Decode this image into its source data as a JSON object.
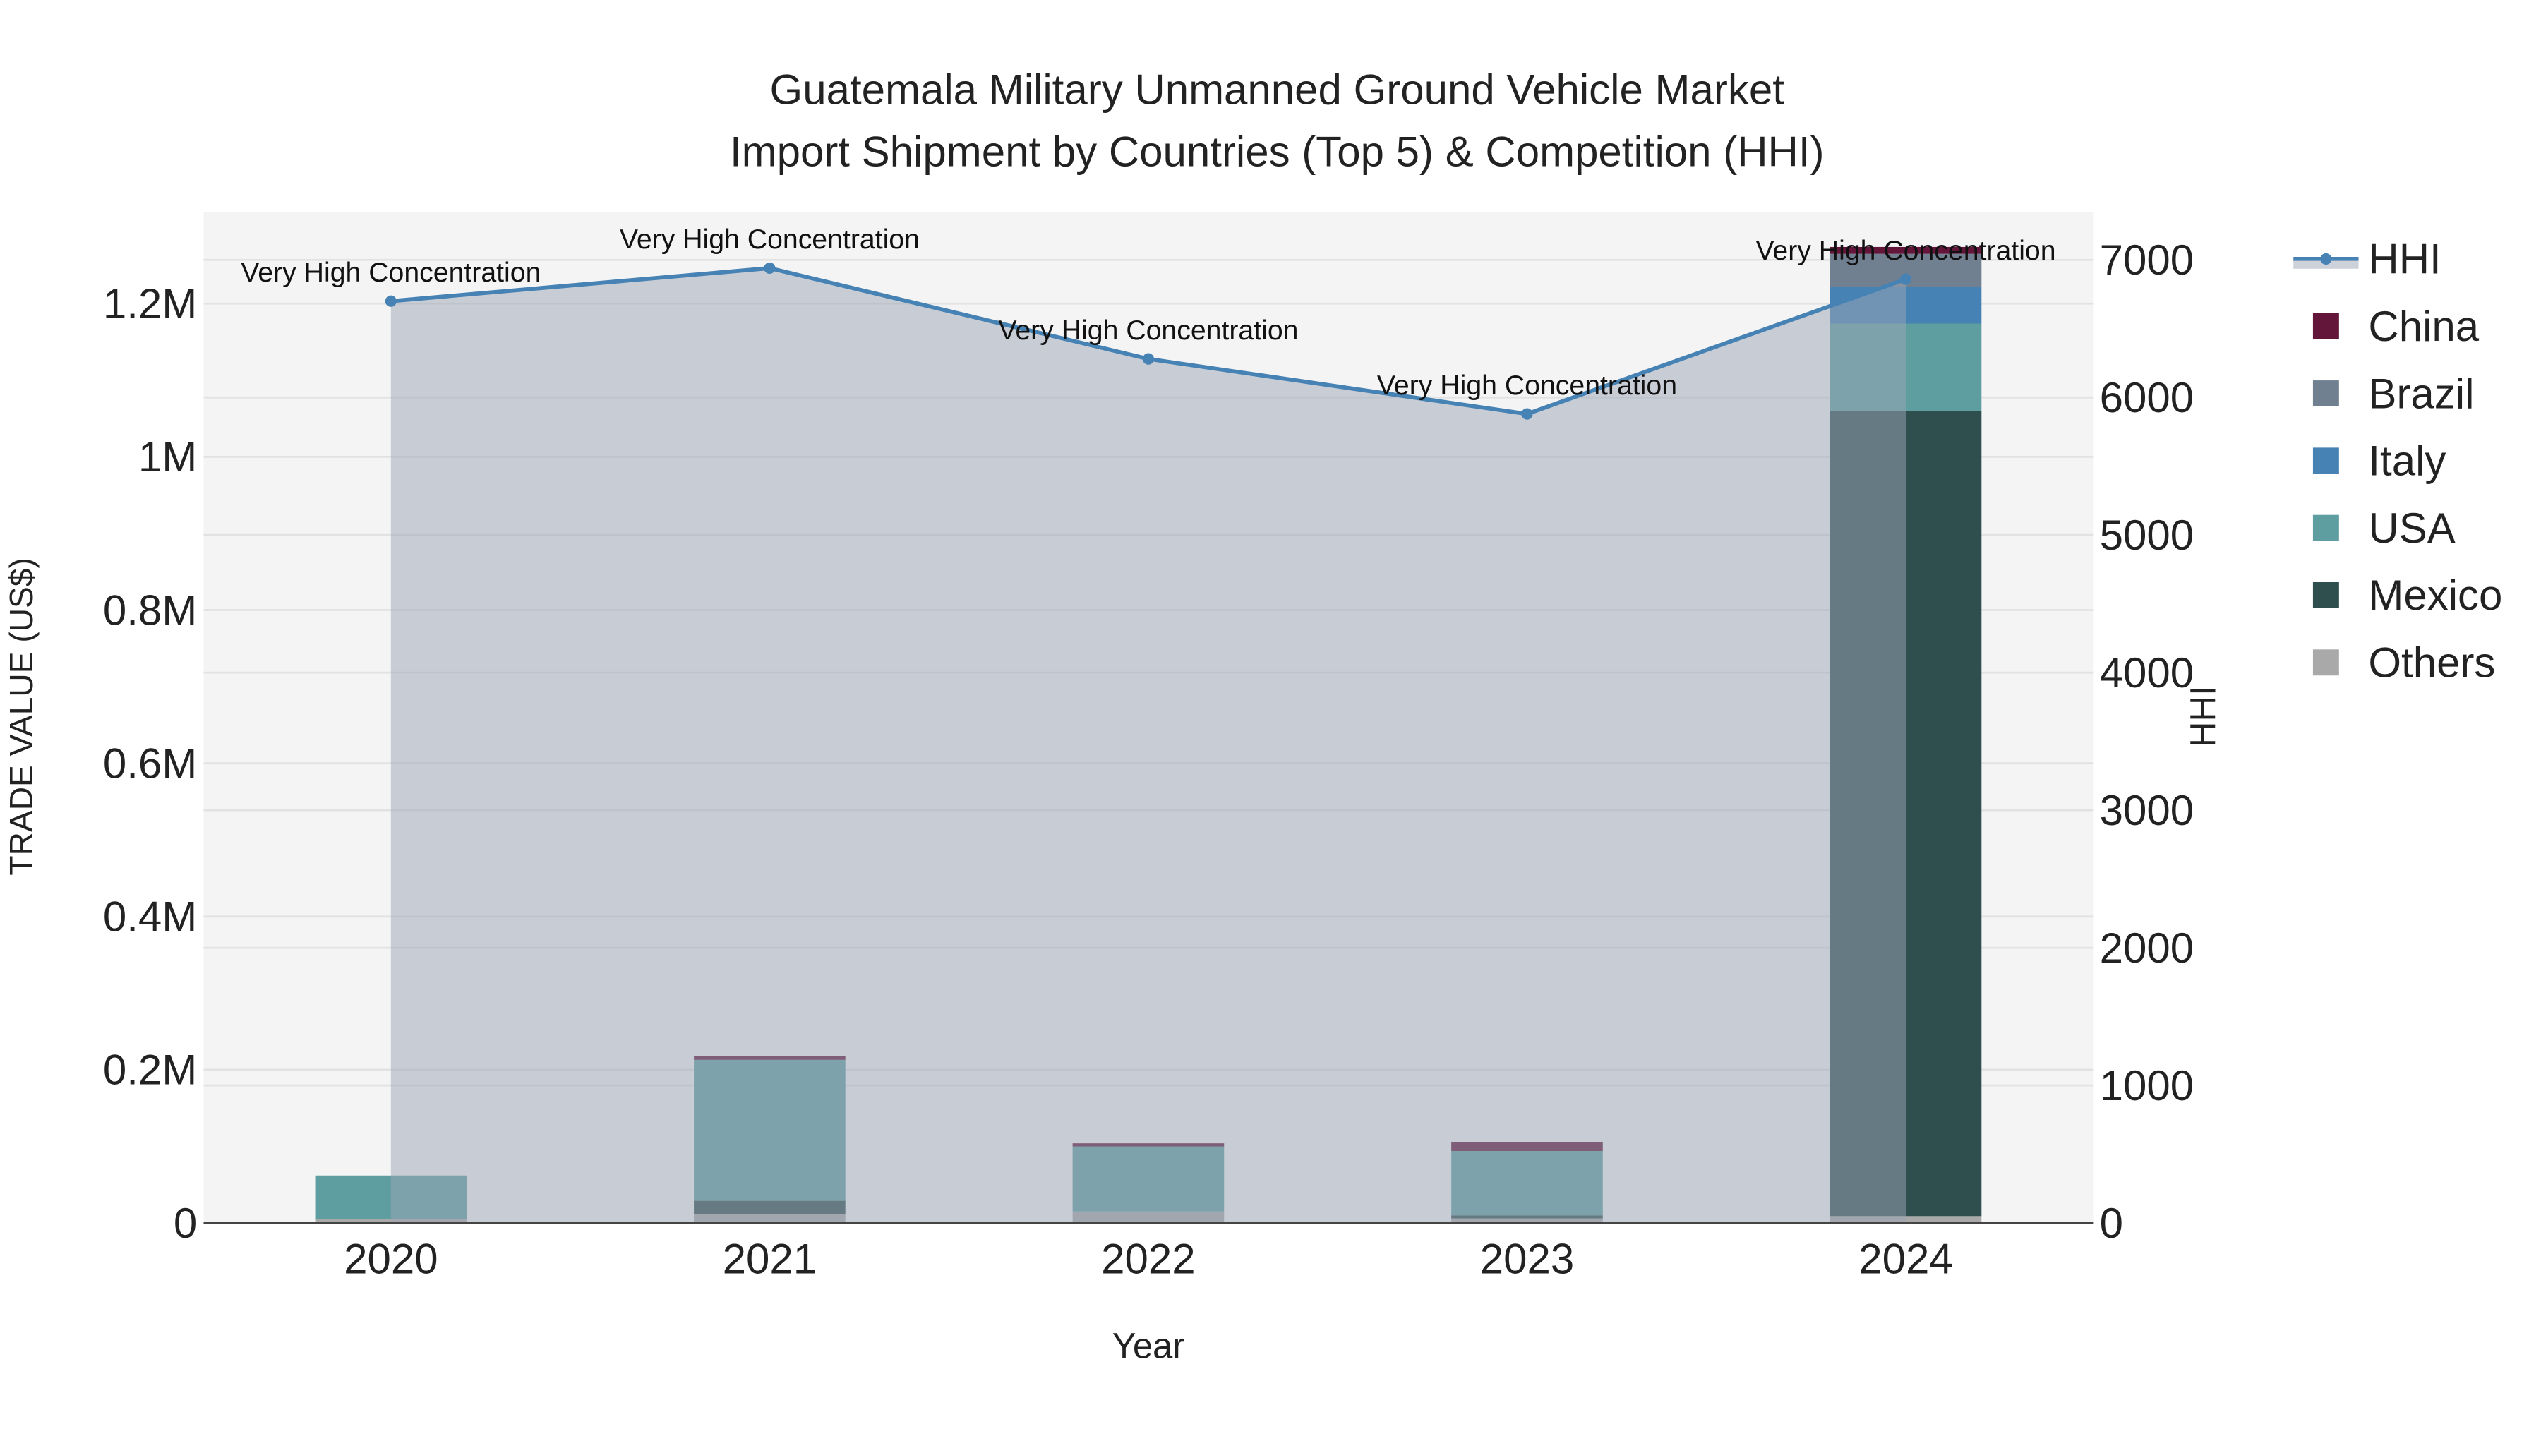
{
  "chart_data": {
    "type": "bar",
    "title_line1": "Guatemala Military Unmanned Ground Vehicle Market",
    "title_line2": "Import Shipment by Countries (Top 5) & Competition (HHI)",
    "xlabel": "Year",
    "ylabel": "TRADE VALUE (US$)",
    "y2label": "HHI",
    "categories": [
      "2020",
      "2021",
      "2022",
      "2023",
      "2024"
    ],
    "ylim": [
      0,
      1320000
    ],
    "y2lim": [
      0,
      7350
    ],
    "yticks": [
      0,
      200000,
      400000,
      600000,
      800000,
      1000000,
      1200000
    ],
    "ytick_labels": [
      "0",
      "0.2M",
      "0.4M",
      "0.6M",
      "0.8M",
      "1M",
      "1.2M"
    ],
    "y2ticks": [
      0,
      1000,
      2000,
      3000,
      4000,
      5000,
      6000,
      7000
    ],
    "y2tick_labels": [
      "0",
      "1000",
      "2000",
      "3000",
      "4000",
      "5000",
      "6000",
      "7000"
    ],
    "stack_order": [
      "Others",
      "Mexico",
      "USA",
      "Italy",
      "Brazil",
      "China"
    ],
    "series": [
      {
        "name": "China",
        "color": "#63153a",
        "values": [
          0,
          5000,
          4000,
          12000,
          9000
        ]
      },
      {
        "name": "Brazil",
        "color": "#708090",
        "values": [
          0,
          0,
          0,
          0,
          43000
        ]
      },
      {
        "name": "Italy",
        "color": "#4682b4",
        "values": [
          0,
          0,
          0,
          0,
          48000
        ]
      },
      {
        "name": "USA",
        "color": "#5f9ea0",
        "values": [
          57000,
          184000,
          85000,
          84000,
          114000
        ]
      },
      {
        "name": "Mexico",
        "color": "#2f4f4f",
        "values": [
          0,
          17000,
          0,
          4000,
          1051000
        ]
      },
      {
        "name": "Others",
        "color": "#a9a9a9",
        "values": [
          5000,
          12000,
          15000,
          6000,
          9000
        ]
      }
    ],
    "hhi": {
      "name": "HHI",
      "color": "#4682b4",
      "values": [
        6700,
        6940,
        6280,
        5880,
        6860
      ],
      "annotations": [
        "Very High Concentration",
        "Very High Concentration",
        "Very High Concentration",
        "Very High Concentration",
        "Very High Concentration"
      ]
    },
    "legend_position": "right",
    "legend": [
      "HHI",
      "China",
      "Brazil",
      "Italy",
      "USA",
      "Mexico",
      "Others"
    ],
    "grid": true
  }
}
